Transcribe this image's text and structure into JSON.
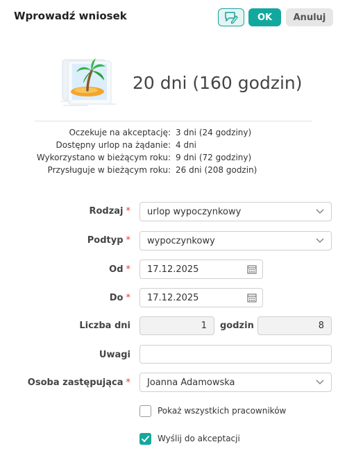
{
  "header": {
    "title": "Wprowadź wniosek",
    "ok_label": "OK",
    "cancel_label": "Anuluj"
  },
  "summary": {
    "days_total": "20 dni (160 godzin)",
    "rows": [
      {
        "label": "Oczekuje na akceptację:",
        "value": "3 dni (24 godziny)"
      },
      {
        "label": "Dostępny urlop na żądanie:",
        "value": "4 dni"
      },
      {
        "label": "Wykorzystano w bieżącym roku:",
        "value": "9 dni (72 godziny)"
      },
      {
        "label": "Przysługuje w bieżącym roku:",
        "value": "26 dni (208 godzin)"
      }
    ]
  },
  "form": {
    "rodzaj": {
      "label": "Rodzaj",
      "value": "urlop wypoczynkowy"
    },
    "podtyp": {
      "label": "Podtyp",
      "value": "wypoczynkowy"
    },
    "od": {
      "label": "Od",
      "value": "17.12.2025"
    },
    "do": {
      "label": "Do",
      "value": "17.12.2025"
    },
    "liczba_dni": {
      "label": "Liczba dni",
      "value": "1"
    },
    "godzin": {
      "label": "godzin",
      "value": "8"
    },
    "uwagi": {
      "label": "Uwagi",
      "value": ""
    },
    "osoba": {
      "label": "Osoba zastępująca",
      "value": "Joanna Adamowska"
    },
    "required_mark": "*",
    "show_all": {
      "label": "Pokaż wszystkich pracowników",
      "checked": false
    },
    "send": {
      "label": "Wyślij do akceptacji",
      "checked": true
    }
  },
  "colors": {
    "accent": "#13a89e",
    "required": "#e03a3a"
  }
}
